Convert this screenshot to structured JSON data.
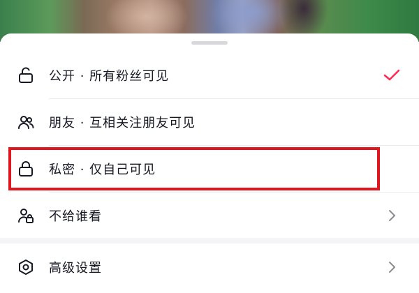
{
  "visibility_sheet": {
    "options": [
      {
        "label": "公开 · 所有粉丝可见",
        "icon": "unlock-icon",
        "selected": true
      },
      {
        "label": "朋友 · 互相关注朋友可见",
        "icon": "friends-icon",
        "selected": false
      },
      {
        "label": "私密 · 仅自己可见",
        "icon": "lock-icon",
        "selected": false,
        "highlighted": true
      },
      {
        "label": "不给谁看",
        "icon": "user-block-icon",
        "selected": false,
        "has_chevron": true
      }
    ],
    "advanced": {
      "label": "高级设置",
      "icon": "settings-hex-icon",
      "has_chevron": true
    }
  },
  "colors": {
    "checkmark": "#fe2c55",
    "highlight_border": "#e0161e",
    "text": "#161823",
    "icon": "#161823",
    "chevron": "#8a8b91"
  }
}
